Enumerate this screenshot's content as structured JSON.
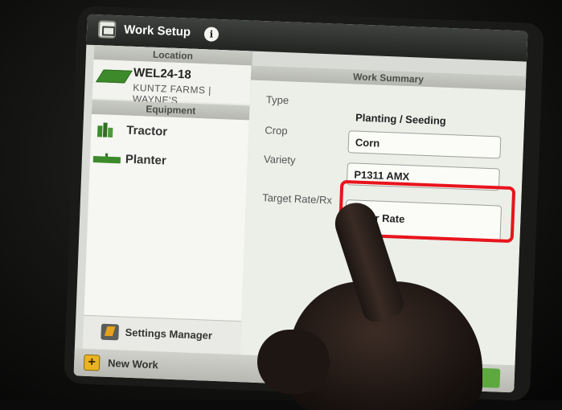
{
  "window": {
    "title": "Work Setup"
  },
  "location": {
    "header": "Location",
    "name": "WEL24-18",
    "subtitle": "KUNTZ FARMS | WAYNE'S"
  },
  "equipment": {
    "header": "Equipment",
    "items": [
      {
        "label": "Tractor",
        "icon": "tractor-icon"
      },
      {
        "label": "Planter",
        "icon": "planter-icon"
      }
    ]
  },
  "settings_manager": {
    "label": "Settings Manager"
  },
  "bottom_bar": {
    "new_work_label": "New Work"
  },
  "work_summary": {
    "header": "Work Summary",
    "rows": [
      {
        "label": "Type",
        "value": "Planting / Seeding"
      },
      {
        "label": "Crop",
        "value": "Corn"
      },
      {
        "label": "Variety",
        "value": "P1311 AMX"
      },
      {
        "label": "Target Rate/Rx",
        "value": "Co     er Rate"
      }
    ]
  },
  "colors": {
    "accent_green": "#3c8a2a",
    "highlight_red": "#e8141c",
    "titlebar": "#2b2d2a"
  }
}
